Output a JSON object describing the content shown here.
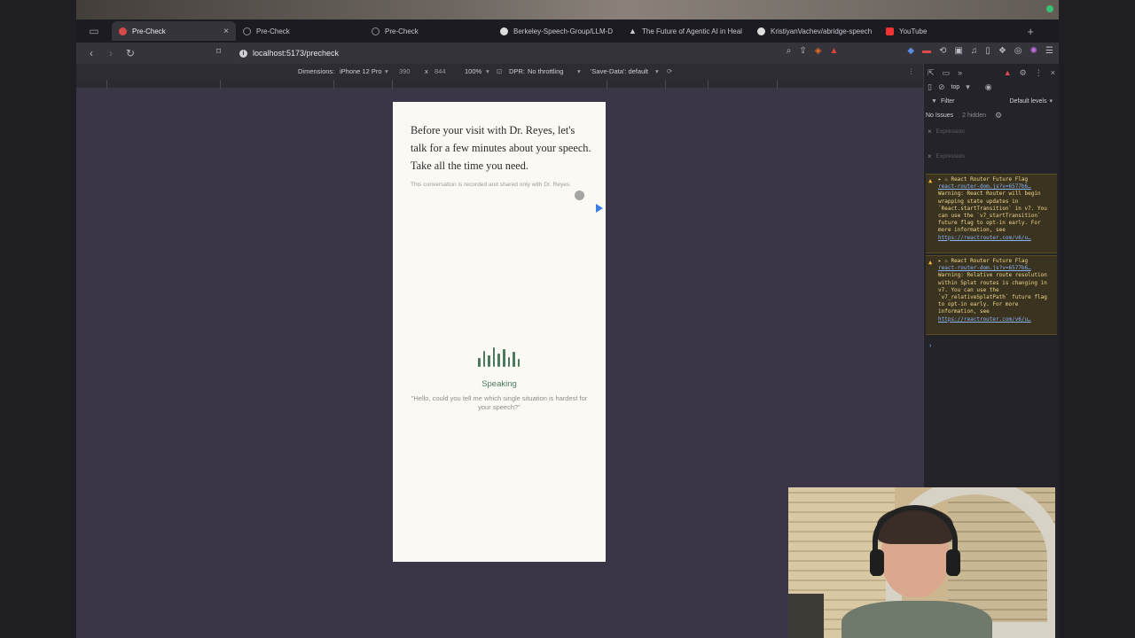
{
  "browser": {
    "tabs": [
      {
        "label": "Pre-Check",
        "active": true
      },
      {
        "label": "Pre-Check",
        "active": false
      },
      {
        "label": "Pre-Check",
        "active": false
      },
      {
        "label": "Berkeley-Speech-Group/LLM-D",
        "active": false
      },
      {
        "label": "The Future of Agentic AI in Heal",
        "active": false
      },
      {
        "label": "KristiyanVachev/abridge-speech",
        "active": false
      },
      {
        "label": "YouTube",
        "active": false
      }
    ],
    "url": "localhost:5173/precheck"
  },
  "device_toolbar": {
    "dimensions_label": "Dimensions:",
    "device": "iPhone 12 Pro",
    "width": "390",
    "times": "x",
    "height": "844",
    "zoom": "100%",
    "dpr_label": "DPR:",
    "throttling": "No throttling",
    "save_data": "'Save-Data': default"
  },
  "page": {
    "intro": "Before your visit with Dr. Reyes, let's talk for a few minutes about your speech. Take all the time you need.",
    "note": "This conversation is recorded and shared only with Dr. Reyes.",
    "status": "Speaking",
    "quote": "\"Hello, could you tell me which single situation is hardest for your speech?\"",
    "wave_levels": [
      0.45,
      0.8,
      0.6,
      1.0,
      0.7,
      0.9,
      0.5,
      0.75,
      0.4
    ]
  },
  "devtools": {
    "context": "top",
    "filter": "Filter",
    "levels": "Default levels",
    "issues": "No Issues",
    "hidden": "2 hidden",
    "expression_placeholder": "Expression",
    "warnings": [
      {
        "title": "React Router Future Flag",
        "source": "react-router-dom.js?v=6577b6…",
        "body": "Warning: React Router will begin wrapping state updates in `React.startTransition` in v7. You can use the `v7_startTransition` future flag to opt-in early. For more information, see",
        "link": "https://reactrouter.com/v6/u…"
      },
      {
        "title": "React Router Future Flag",
        "source": "react-router-dom.js?v=6577b6…",
        "body": "Warning: Relative route resolution within Splat routes is changing in v7. You can use the `v7_relativeSplatPath` future flag to opt-in early. For more information, see",
        "link": "https://reactrouter.com/v6/u…"
      }
    ]
  },
  "colors": {
    "accent_green": "#4b7a5c",
    "viewport_bg": "#3b3647",
    "page_bg": "#fbf9f4"
  }
}
